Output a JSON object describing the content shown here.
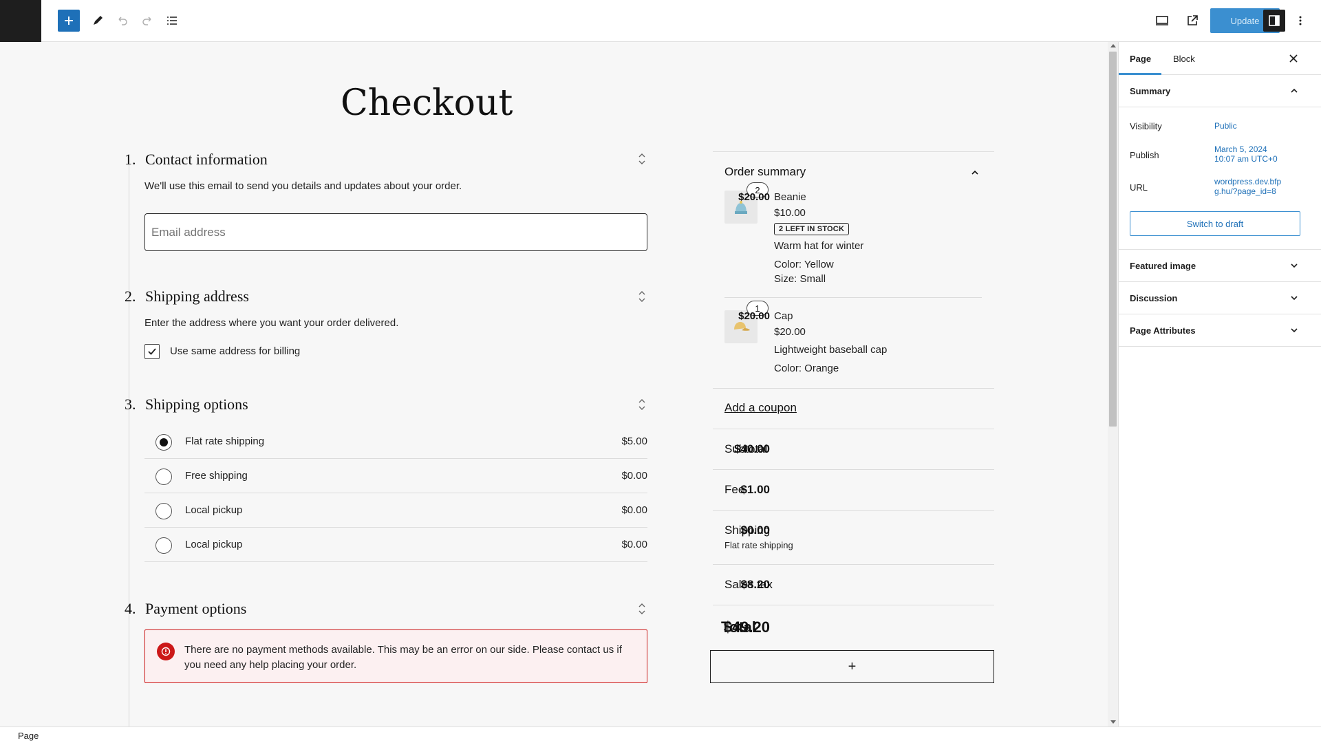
{
  "toolbar": {
    "update_label": "Update"
  },
  "page": {
    "title": "Checkout"
  },
  "steps": [
    {
      "num": "1.",
      "title": "Contact information",
      "desc": "We'll use this email to send you details and updates about your order."
    },
    {
      "num": "2.",
      "title": "Shipping address",
      "desc": "Enter the address where you want your order delivered."
    },
    {
      "num": "3.",
      "title": "Shipping options"
    },
    {
      "num": "4.",
      "title": "Payment options"
    }
  ],
  "contact": {
    "email_placeholder": "Email address"
  },
  "billing": {
    "same_address_label": "Use same address for billing",
    "checked": true
  },
  "shipping_options": [
    {
      "label": "Flat rate shipping",
      "price": "$5.00",
      "selected": true
    },
    {
      "label": "Free shipping",
      "price": "$0.00",
      "selected": false
    },
    {
      "label": "Local pickup",
      "price": "$0.00",
      "selected": false
    },
    {
      "label": "Local pickup",
      "price": "$0.00",
      "selected": false
    }
  ],
  "payment": {
    "error": "There are no payment methods available. This may be an error on our side. Please contact us if you need any help placing your order."
  },
  "order_summary": {
    "title": "Order summary",
    "items": [
      {
        "qty": "2",
        "name": "Beanie",
        "price": "$10.00",
        "stock": "2 LEFT IN STOCK",
        "desc": "Warm hat for winter",
        "attrs": [
          "Color: Yellow",
          "Size: Small"
        ],
        "total": "$20.00"
      },
      {
        "qty": "1",
        "name": "Cap",
        "price": "$20.00",
        "desc": "Lightweight baseball cap",
        "attrs": [
          "Color: Orange"
        ],
        "total": "$20.00"
      }
    ],
    "coupon": "Add a coupon",
    "subtotal_label": "Subtotal",
    "subtotal": "$40.00",
    "fee_label": "Fee",
    "fee": "$1.00",
    "shipping_label": "Shipping",
    "shipping": "$0.00",
    "shipping_sub": "Flat rate shipping",
    "tax_label": "Sales tax",
    "tax": "$8.20",
    "total_label": "Total",
    "total": "$49.20",
    "add_block": "+"
  },
  "sidebar": {
    "tab_page": "Page",
    "tab_block": "Block",
    "summary_label": "Summary",
    "visibility_label": "Visibility",
    "visibility_value": "Public",
    "publish_label": "Publish",
    "publish_value_1": "March 5, 2024",
    "publish_value_2": "10:07 am UTC+0",
    "url_label": "URL",
    "url_value_1": "wordpress.dev.bfp",
    "url_value_2": "g.hu/?page_id=8",
    "switch_draft": "Switch to draft",
    "featured_image": "Featured image",
    "discussion": "Discussion",
    "page_attributes": "Page Attributes"
  },
  "footer": {
    "breadcrumb": "Page"
  },
  "colors": {
    "accent": "#3b8fd0",
    "error": "#cc1818"
  }
}
